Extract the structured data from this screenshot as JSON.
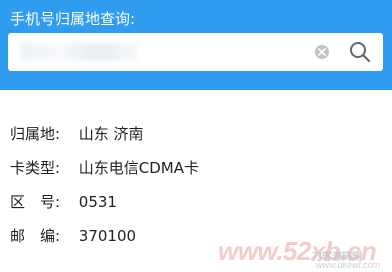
{
  "header": {
    "title": "手机号归属地查询:",
    "background_color": "#2f9cf0"
  },
  "search": {
    "value": "",
    "placeholder": "",
    "clear_icon": "close-circle-icon",
    "search_icon": "magnifier-icon"
  },
  "results": {
    "location": {
      "label": "归属地:",
      "value": "山东 济南"
    },
    "card_type": {
      "label": "卡类型:",
      "value": "山东电信CDMA卡"
    },
    "area_code": {
      "label": "区　号:",
      "value": "0531"
    },
    "postal_code": {
      "label": "邮　编:",
      "value": "370100"
    }
  },
  "watermark": {
    "main": "www.52xb.cn",
    "sub": "刀客源码网",
    "domain": "www.dkewl.com"
  }
}
